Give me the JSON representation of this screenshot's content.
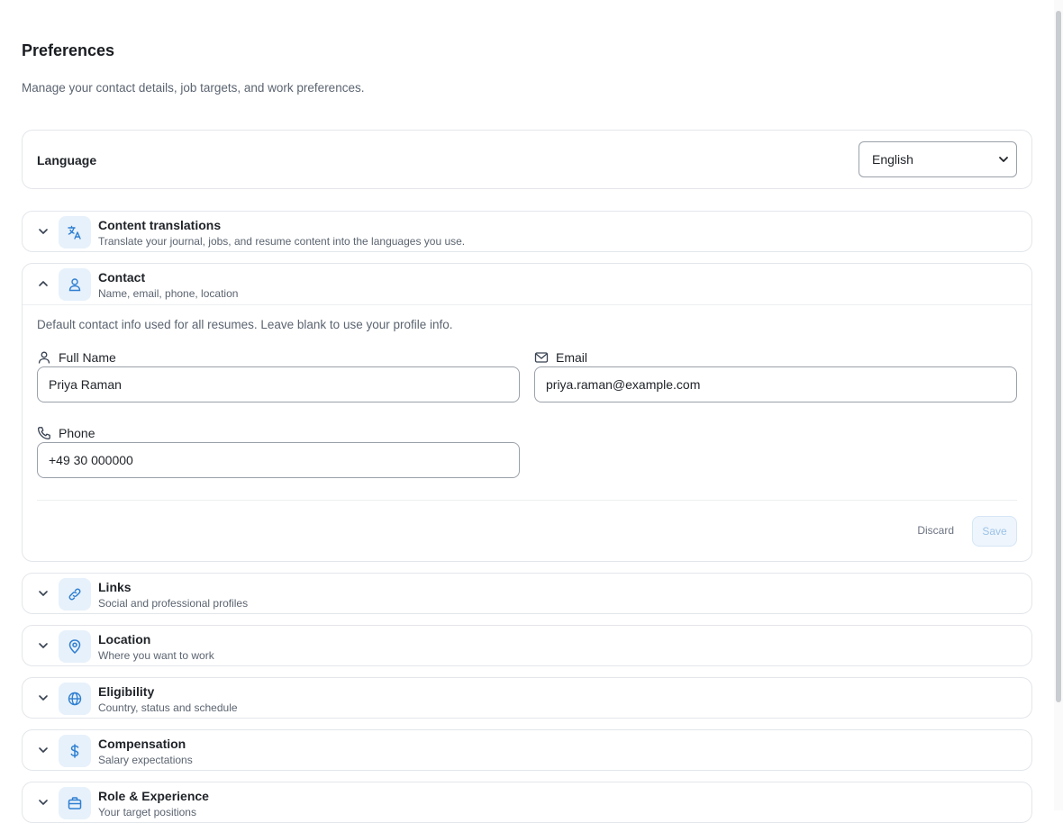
{
  "header": {
    "title": "Preferences",
    "subtitle": "Manage your contact details, job targets, and work preferences."
  },
  "language": {
    "label": "Language",
    "selected": "English"
  },
  "sections": [
    {
      "title": "Content translations",
      "subtitle": "Translate your journal, jobs, and resume content into the languages you use.",
      "icon": "translate-icon",
      "expanded": false
    },
    {
      "title": "Contact",
      "subtitle": "Name, email, phone, location",
      "icon": "user-icon",
      "expanded": true
    },
    {
      "title": "Links",
      "subtitle": "Social and professional profiles",
      "icon": "link-icon",
      "expanded": false
    },
    {
      "title": "Location",
      "subtitle": "Where you want to work",
      "icon": "map-pin-icon",
      "expanded": false
    },
    {
      "title": "Eligibility",
      "subtitle": "Country, status and schedule",
      "icon": "globe-icon",
      "expanded": false
    },
    {
      "title": "Compensation",
      "subtitle": "Salary expectations",
      "icon": "dollar-icon",
      "expanded": false
    },
    {
      "title": "Role & Experience",
      "subtitle": "Your target positions",
      "icon": "briefcase-icon",
      "expanded": false
    }
  ],
  "contact": {
    "description": "Default contact info used for all resumes. Leave blank to use your profile info.",
    "full_name_label": "Full Name",
    "full_name_value": "Priya Raman",
    "email_label": "Email",
    "email_value": "priya.raman@example.com",
    "phone_label": "Phone",
    "phone_value": "+49 30 000000",
    "discard_label": "Discard",
    "save_label": "Save"
  },
  "colors": {
    "accent": "#2f7fd1",
    "icon_bg": "#e7f1fb",
    "border": "#e3e6ea"
  }
}
